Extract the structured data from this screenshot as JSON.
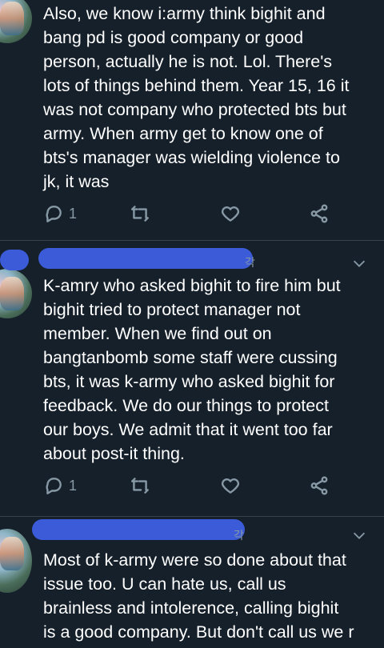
{
  "tweets": [
    {
      "text": "Also, we know i:army think bighit and\nbang pd is good company or good\nperson, actually he is not. Lol. There's\nlots of things behind them. Year 15, 16 it\nwas not company who protected bts but\narmy. When army get to know one of\nbts's manager was wielding violence to\njk, it was",
      "reply_count": "1",
      "time_fragment": ""
    },
    {
      "text": "K-amry who asked bighit to fire him but\nbighit tried to protect manager not\nmember. When we find out on\nbangtanbomb some staff were cussing\nbts, it was k-army who asked bighit for\nfeedback. We do our things to protect\nour boys. We admit that it went too far\nabout post-it thing.",
      "reply_count": "1",
      "time_fragment": "각"
    },
    {
      "text": "Most of k-army were so done about that\nissue too. U can hate us, call us\nbrainless and intolerence, calling bighit\nis a good company. But don't call us we r",
      "reply_count": "",
      "time_fragment": "각"
    }
  ],
  "icons": {
    "reply": "reply-icon",
    "retweet": "retweet-icon",
    "like": "heart-icon",
    "share": "share-icon",
    "more": "chevron-down-icon"
  },
  "colors": {
    "background": "#15202b",
    "text": "#ffffff",
    "muted": "#8899a6",
    "redaction": "#3b5bd9"
  }
}
